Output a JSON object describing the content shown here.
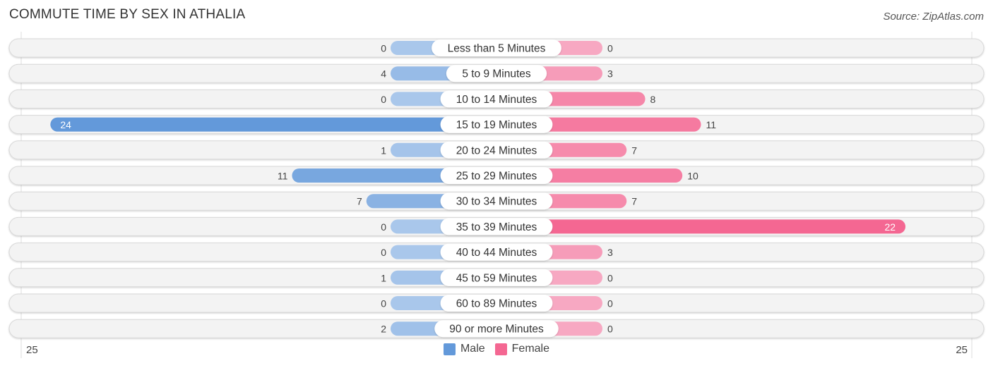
{
  "title": "COMMUTE TIME BY SEX IN ATHALIA",
  "source": "Source: ZipAtlas.com",
  "colors": {
    "male": "#6399da",
    "male_light": "#a9c7eb",
    "female": "#f46792",
    "female_light": "#f7a8c2",
    "row_bg": "#f3f3f3"
  },
  "legend": [
    {
      "label": "Male",
      "color": "#6399da"
    },
    {
      "label": "Female",
      "color": "#f46792"
    }
  ],
  "axis": {
    "left_label": "25",
    "right_label": "25"
  },
  "chart_data": {
    "type": "bar",
    "orientation": "horizontal-diverging",
    "title": "COMMUTE TIME BY SEX IN ATHALIA",
    "categories": [
      "Less than 5 Minutes",
      "5 to 9 Minutes",
      "10 to 14 Minutes",
      "15 to 19 Minutes",
      "20 to 24 Minutes",
      "25 to 29 Minutes",
      "30 to 34 Minutes",
      "35 to 39 Minutes",
      "40 to 44 Minutes",
      "45 to 59 Minutes",
      "60 to 89 Minutes",
      "90 or more Minutes"
    ],
    "series": [
      {
        "name": "Male",
        "values": [
          0,
          4,
          0,
          24,
          1,
          11,
          7,
          0,
          0,
          1,
          0,
          2
        ]
      },
      {
        "name": "Female",
        "values": [
          0,
          3,
          8,
          11,
          7,
          10,
          7,
          22,
          3,
          0,
          0,
          0
        ]
      }
    ],
    "xlim": [
      -25,
      25
    ],
    "xlabel": "",
    "ylabel": "",
    "tick_labels": [
      "25",
      "25"
    ],
    "legend_position": "bottom-center",
    "grid": false
  }
}
